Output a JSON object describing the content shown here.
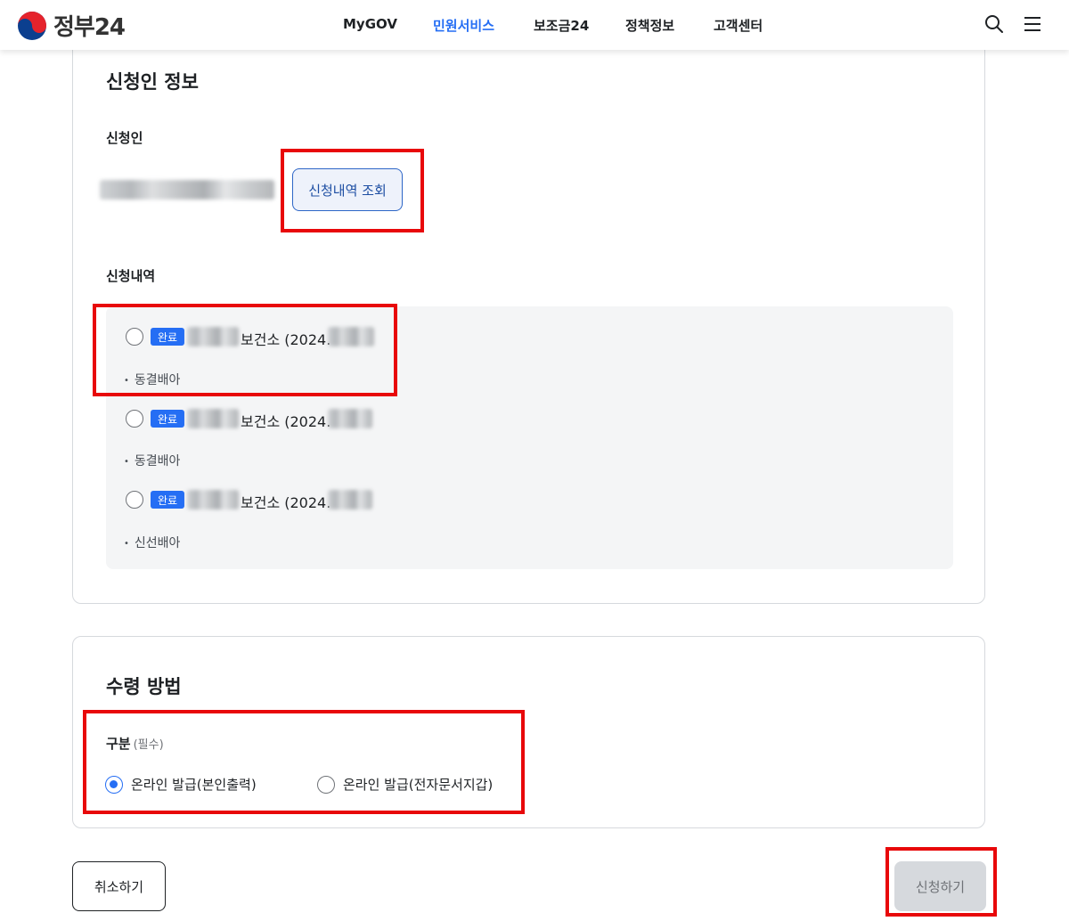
{
  "header": {
    "logo_text": "정부24",
    "nav": [
      {
        "label": "MyGOV",
        "active": false
      },
      {
        "label": "민원서비스",
        "active": true
      },
      {
        "label": "보조금24",
        "active": false
      },
      {
        "label": "정책정보",
        "active": false
      },
      {
        "label": "고객센터",
        "active": false
      }
    ],
    "icons": [
      "search-icon",
      "menu-icon"
    ]
  },
  "applicant_section": {
    "title": "신청인 정보",
    "applicant_label": "신청인",
    "lookup_button": "신청내역 조회",
    "history_label": "신청내역",
    "items": [
      {
        "status": "완료",
        "name_suffix": "보건소 (2024.",
        "detail": "동결배아",
        "selected": false
      },
      {
        "status": "완료",
        "name_suffix": "보건소 (2024.",
        "detail": "동결배아",
        "selected": false
      },
      {
        "status": "완료",
        "name_suffix": "보건소 (2024.",
        "detail": "신선배아",
        "selected": false
      }
    ]
  },
  "receive_section": {
    "title": "수령 방법",
    "category_label": "구분",
    "required_label": "(필수)",
    "options": [
      {
        "label": "온라인 발급(본인출력)",
        "selected": true
      },
      {
        "label": "온라인 발급(전자문서지갑)",
        "selected": false
      }
    ]
  },
  "actions": {
    "cancel_label": "취소하기",
    "submit_label": "신청하기"
  },
  "colors": {
    "primary": "#256ef4",
    "highlight": "#e8080a",
    "disabled_button": "#d6d9dd"
  }
}
